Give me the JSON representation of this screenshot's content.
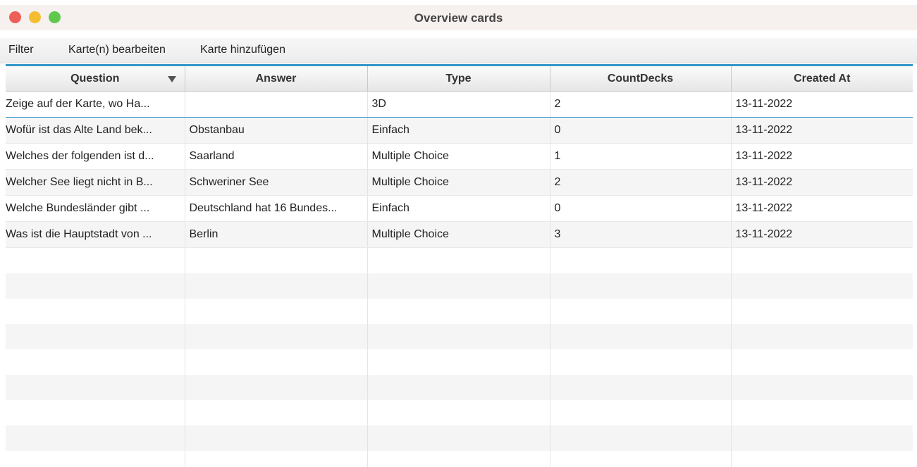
{
  "window": {
    "title": "Overview cards",
    "controls": [
      "close",
      "minimize",
      "maximize"
    ]
  },
  "menu": {
    "items": [
      {
        "label": "Filter"
      },
      {
        "label": "Karte(n) bearbeiten"
      },
      {
        "label": "Karte hinzufügen"
      }
    ]
  },
  "table": {
    "columns": [
      "Question",
      "Answer",
      "Type",
      "CountDecks",
      "Created At"
    ],
    "sort_column": "Question",
    "rows": [
      [
        "Zeige auf der Karte, wo Ha...",
        "",
        "3D",
        "2",
        "13-11-2022"
      ],
      [
        "Wofür ist das Alte Land bek...",
        "Obstanbau",
        "Einfach",
        "0",
        "13-11-2022"
      ],
      [
        "Welches der folgenden ist d...",
        "Saarland",
        "Multiple Choice",
        "1",
        "13-11-2022"
      ],
      [
        "Welcher See liegt nicht in B...",
        "Schweriner See",
        "Multiple Choice",
        "2",
        "13-11-2022"
      ],
      [
        "Welche Bundesländer gibt ...",
        "Deutschland hat 16 Bundes...",
        "Einfach",
        "0",
        "13-11-2022"
      ],
      [
        "Was ist die Hauptstadt von ...",
        "Berlin",
        "Multiple Choice",
        "3",
        "13-11-2022"
      ]
    ],
    "selected_row": 0
  },
  "colors": {
    "accent": "#3498c9",
    "close": "#ee5f58",
    "minimize": "#f5bd31",
    "maximize": "#5fc84d"
  }
}
